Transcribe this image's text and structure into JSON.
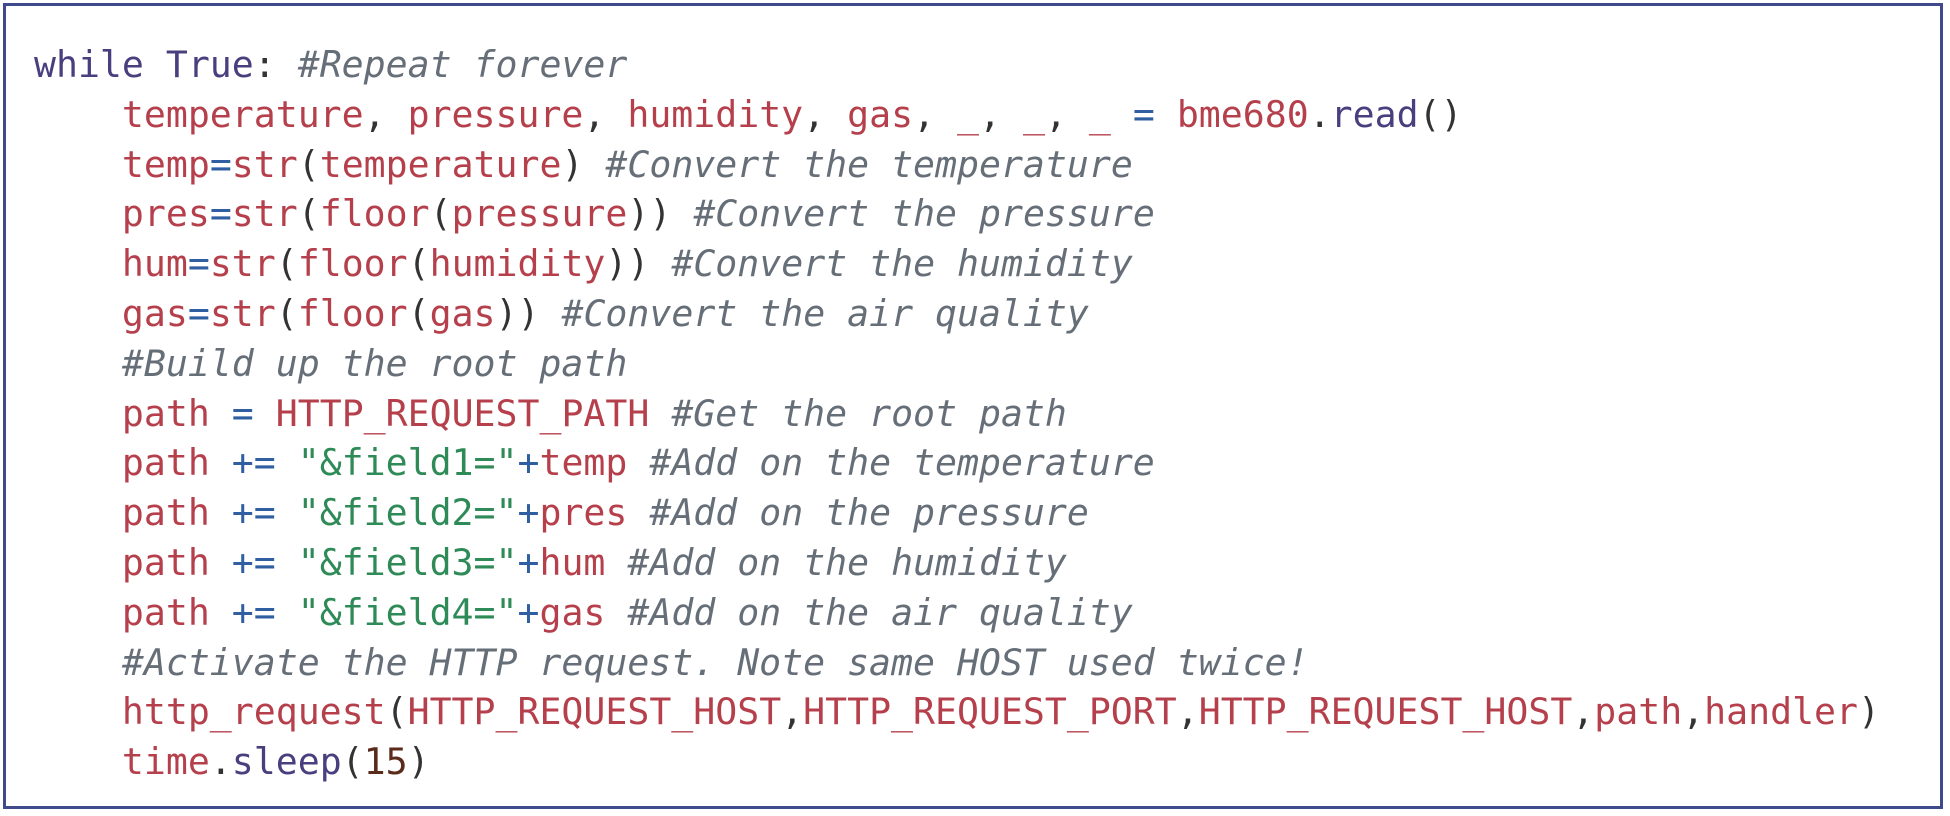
{
  "code_lines": [
    {
      "indent": "",
      "tokens": [
        {
          "t": "kw",
          "v": "while"
        },
        {
          "t": "pun",
          "v": " "
        },
        {
          "t": "kw",
          "v": "True"
        },
        {
          "t": "pun",
          "v": ": "
        },
        {
          "t": "cm",
          "v": "#Repeat forever"
        }
      ]
    },
    {
      "indent": "    ",
      "tokens": [
        {
          "t": "var",
          "v": "temperature"
        },
        {
          "t": "pun",
          "v": ", "
        },
        {
          "t": "var",
          "v": "pressure"
        },
        {
          "t": "pun",
          "v": ", "
        },
        {
          "t": "var",
          "v": "humidity"
        },
        {
          "t": "pun",
          "v": ", "
        },
        {
          "t": "var",
          "v": "gas"
        },
        {
          "t": "pun",
          "v": ", "
        },
        {
          "t": "var",
          "v": "_"
        },
        {
          "t": "pun",
          "v": ", "
        },
        {
          "t": "var",
          "v": "_"
        },
        {
          "t": "pun",
          "v": ", "
        },
        {
          "t": "var",
          "v": "_"
        },
        {
          "t": "pun",
          "v": " "
        },
        {
          "t": "op",
          "v": "="
        },
        {
          "t": "pun",
          "v": " "
        },
        {
          "t": "var",
          "v": "bme680"
        },
        {
          "t": "pun",
          "v": "."
        },
        {
          "t": "fn",
          "v": "read"
        },
        {
          "t": "pun",
          "v": "()"
        }
      ]
    },
    {
      "indent": "    ",
      "tokens": [
        {
          "t": "var",
          "v": "temp"
        },
        {
          "t": "op",
          "v": "="
        },
        {
          "t": "var",
          "v": "str"
        },
        {
          "t": "pun",
          "v": "("
        },
        {
          "t": "var",
          "v": "temperature"
        },
        {
          "t": "pun",
          "v": ") "
        },
        {
          "t": "cm",
          "v": "#Convert the temperature"
        }
      ]
    },
    {
      "indent": "    ",
      "tokens": [
        {
          "t": "var",
          "v": "pres"
        },
        {
          "t": "op",
          "v": "="
        },
        {
          "t": "var",
          "v": "str"
        },
        {
          "t": "pun",
          "v": "("
        },
        {
          "t": "var",
          "v": "floor"
        },
        {
          "t": "pun",
          "v": "("
        },
        {
          "t": "var",
          "v": "pressure"
        },
        {
          "t": "pun",
          "v": ")) "
        },
        {
          "t": "cm",
          "v": "#Convert the pressure"
        }
      ]
    },
    {
      "indent": "    ",
      "tokens": [
        {
          "t": "var",
          "v": "hum"
        },
        {
          "t": "op",
          "v": "="
        },
        {
          "t": "var",
          "v": "str"
        },
        {
          "t": "pun",
          "v": "("
        },
        {
          "t": "var",
          "v": "floor"
        },
        {
          "t": "pun",
          "v": "("
        },
        {
          "t": "var",
          "v": "humidity"
        },
        {
          "t": "pun",
          "v": ")) "
        },
        {
          "t": "cm",
          "v": "#Convert the humidity"
        }
      ]
    },
    {
      "indent": "    ",
      "tokens": [
        {
          "t": "var",
          "v": "gas"
        },
        {
          "t": "op",
          "v": "="
        },
        {
          "t": "var",
          "v": "str"
        },
        {
          "t": "pun",
          "v": "("
        },
        {
          "t": "var",
          "v": "floor"
        },
        {
          "t": "pun",
          "v": "("
        },
        {
          "t": "var",
          "v": "gas"
        },
        {
          "t": "pun",
          "v": ")) "
        },
        {
          "t": "cm",
          "v": "#Convert the air quality"
        }
      ]
    },
    {
      "indent": "    ",
      "tokens": [
        {
          "t": "cm",
          "v": "#Build up the root path"
        }
      ]
    },
    {
      "indent": "    ",
      "tokens": [
        {
          "t": "var",
          "v": "path"
        },
        {
          "t": "pun",
          "v": " "
        },
        {
          "t": "op",
          "v": "="
        },
        {
          "t": "pun",
          "v": " "
        },
        {
          "t": "var",
          "v": "HTTP_REQUEST_PATH"
        },
        {
          "t": "pun",
          "v": " "
        },
        {
          "t": "cm",
          "v": "#Get the root path"
        }
      ]
    },
    {
      "indent": "    ",
      "tokens": [
        {
          "t": "var",
          "v": "path"
        },
        {
          "t": "pun",
          "v": " "
        },
        {
          "t": "op",
          "v": "+="
        },
        {
          "t": "pun",
          "v": " "
        },
        {
          "t": "str",
          "v": "\"&field1=\""
        },
        {
          "t": "op",
          "v": "+"
        },
        {
          "t": "var",
          "v": "temp"
        },
        {
          "t": "pun",
          "v": " "
        },
        {
          "t": "cm",
          "v": "#Add on the temperature"
        }
      ]
    },
    {
      "indent": "    ",
      "tokens": [
        {
          "t": "var",
          "v": "path"
        },
        {
          "t": "pun",
          "v": " "
        },
        {
          "t": "op",
          "v": "+="
        },
        {
          "t": "pun",
          "v": " "
        },
        {
          "t": "str",
          "v": "\"&field2=\""
        },
        {
          "t": "op",
          "v": "+"
        },
        {
          "t": "var",
          "v": "pres"
        },
        {
          "t": "pun",
          "v": " "
        },
        {
          "t": "cm",
          "v": "#Add on the pressure"
        }
      ]
    },
    {
      "indent": "    ",
      "tokens": [
        {
          "t": "var",
          "v": "path"
        },
        {
          "t": "pun",
          "v": " "
        },
        {
          "t": "op",
          "v": "+="
        },
        {
          "t": "pun",
          "v": " "
        },
        {
          "t": "str",
          "v": "\"&field3=\""
        },
        {
          "t": "op",
          "v": "+"
        },
        {
          "t": "var",
          "v": "hum"
        },
        {
          "t": "pun",
          "v": " "
        },
        {
          "t": "cm",
          "v": "#Add on the humidity"
        }
      ]
    },
    {
      "indent": "    ",
      "tokens": [
        {
          "t": "var",
          "v": "path"
        },
        {
          "t": "pun",
          "v": " "
        },
        {
          "t": "op",
          "v": "+="
        },
        {
          "t": "pun",
          "v": " "
        },
        {
          "t": "str",
          "v": "\"&field4=\""
        },
        {
          "t": "op",
          "v": "+"
        },
        {
          "t": "var",
          "v": "gas"
        },
        {
          "t": "pun",
          "v": " "
        },
        {
          "t": "cm",
          "v": "#Add on the air quality"
        }
      ]
    },
    {
      "indent": "    ",
      "tokens": [
        {
          "t": "cm",
          "v": "#Activate the HTTP request. Note same HOST used twice!"
        }
      ]
    },
    {
      "indent": "    ",
      "tokens": [
        {
          "t": "var",
          "v": "http_request"
        },
        {
          "t": "pun",
          "v": "("
        },
        {
          "t": "var",
          "v": "HTTP_REQUEST_HOST"
        },
        {
          "t": "pun",
          "v": ","
        },
        {
          "t": "var",
          "v": "HTTP_REQUEST_PORT"
        },
        {
          "t": "pun",
          "v": ","
        },
        {
          "t": "var",
          "v": "HTTP_REQUEST_HOST"
        },
        {
          "t": "pun",
          "v": ","
        },
        {
          "t": "var",
          "v": "path"
        },
        {
          "t": "pun",
          "v": ","
        },
        {
          "t": "var",
          "v": "handler"
        },
        {
          "t": "pun",
          "v": ")"
        }
      ]
    },
    {
      "indent": "    ",
      "tokens": [
        {
          "t": "var",
          "v": "time"
        },
        {
          "t": "pun",
          "v": "."
        },
        {
          "t": "fn",
          "v": "sleep"
        },
        {
          "t": "pun",
          "v": "("
        },
        {
          "t": "num",
          "v": "15"
        },
        {
          "t": "pun",
          "v": ")"
        }
      ]
    }
  ],
  "colors": {
    "border": "#3f4a8c",
    "keyword": "#4a3f7e",
    "identifier": "#b5404c",
    "string": "#2e8a57",
    "operator": "#2f5fa0",
    "comment": "#666e78",
    "number": "#5a2a1a"
  }
}
